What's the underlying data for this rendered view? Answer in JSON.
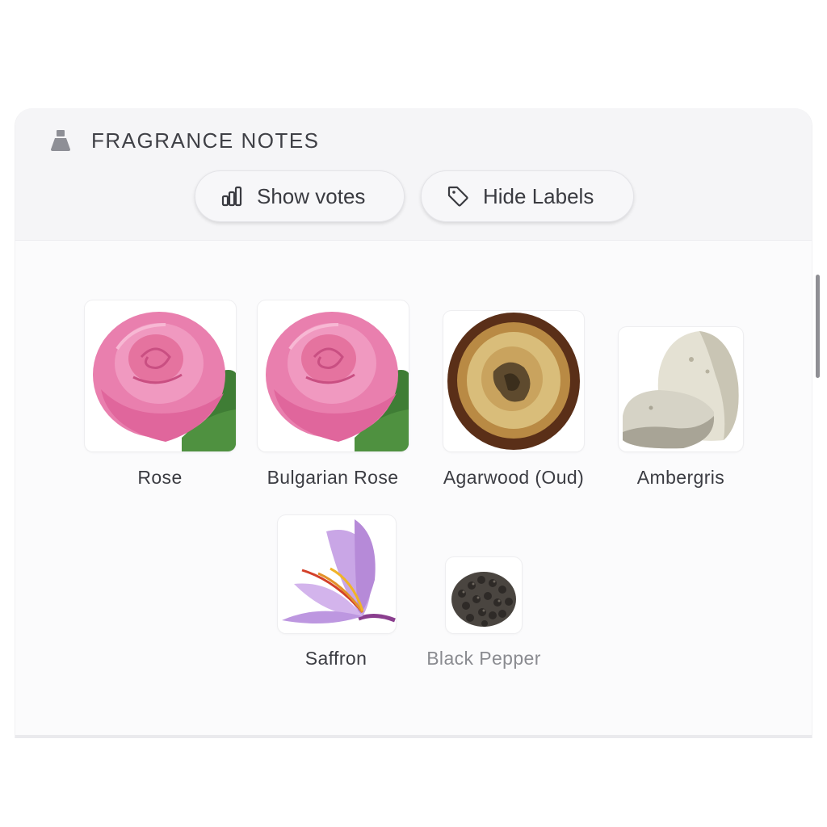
{
  "section": {
    "title": "FRAGRANCE NOTES",
    "title_icon": "perfume-bottle-icon"
  },
  "toolbar": {
    "show_votes_label": "Show votes",
    "show_votes_icon": "bar-chart-icon",
    "hide_labels_label": "Hide Labels",
    "hide_labels_icon": "tag-icon"
  },
  "notes": [
    {
      "label": "Rose",
      "image": "pink-rose"
    },
    {
      "label": "Bulgarian Rose",
      "image": "pink-rose"
    },
    {
      "label": "Agarwood (Oud)",
      "image": "agarwood-slice"
    },
    {
      "label": "Ambergris",
      "image": "ambergris-stones"
    },
    {
      "label": "Saffron",
      "image": "saffron-flower"
    },
    {
      "label": "Black Pepper",
      "image": "black-peppercorns"
    }
  ]
}
